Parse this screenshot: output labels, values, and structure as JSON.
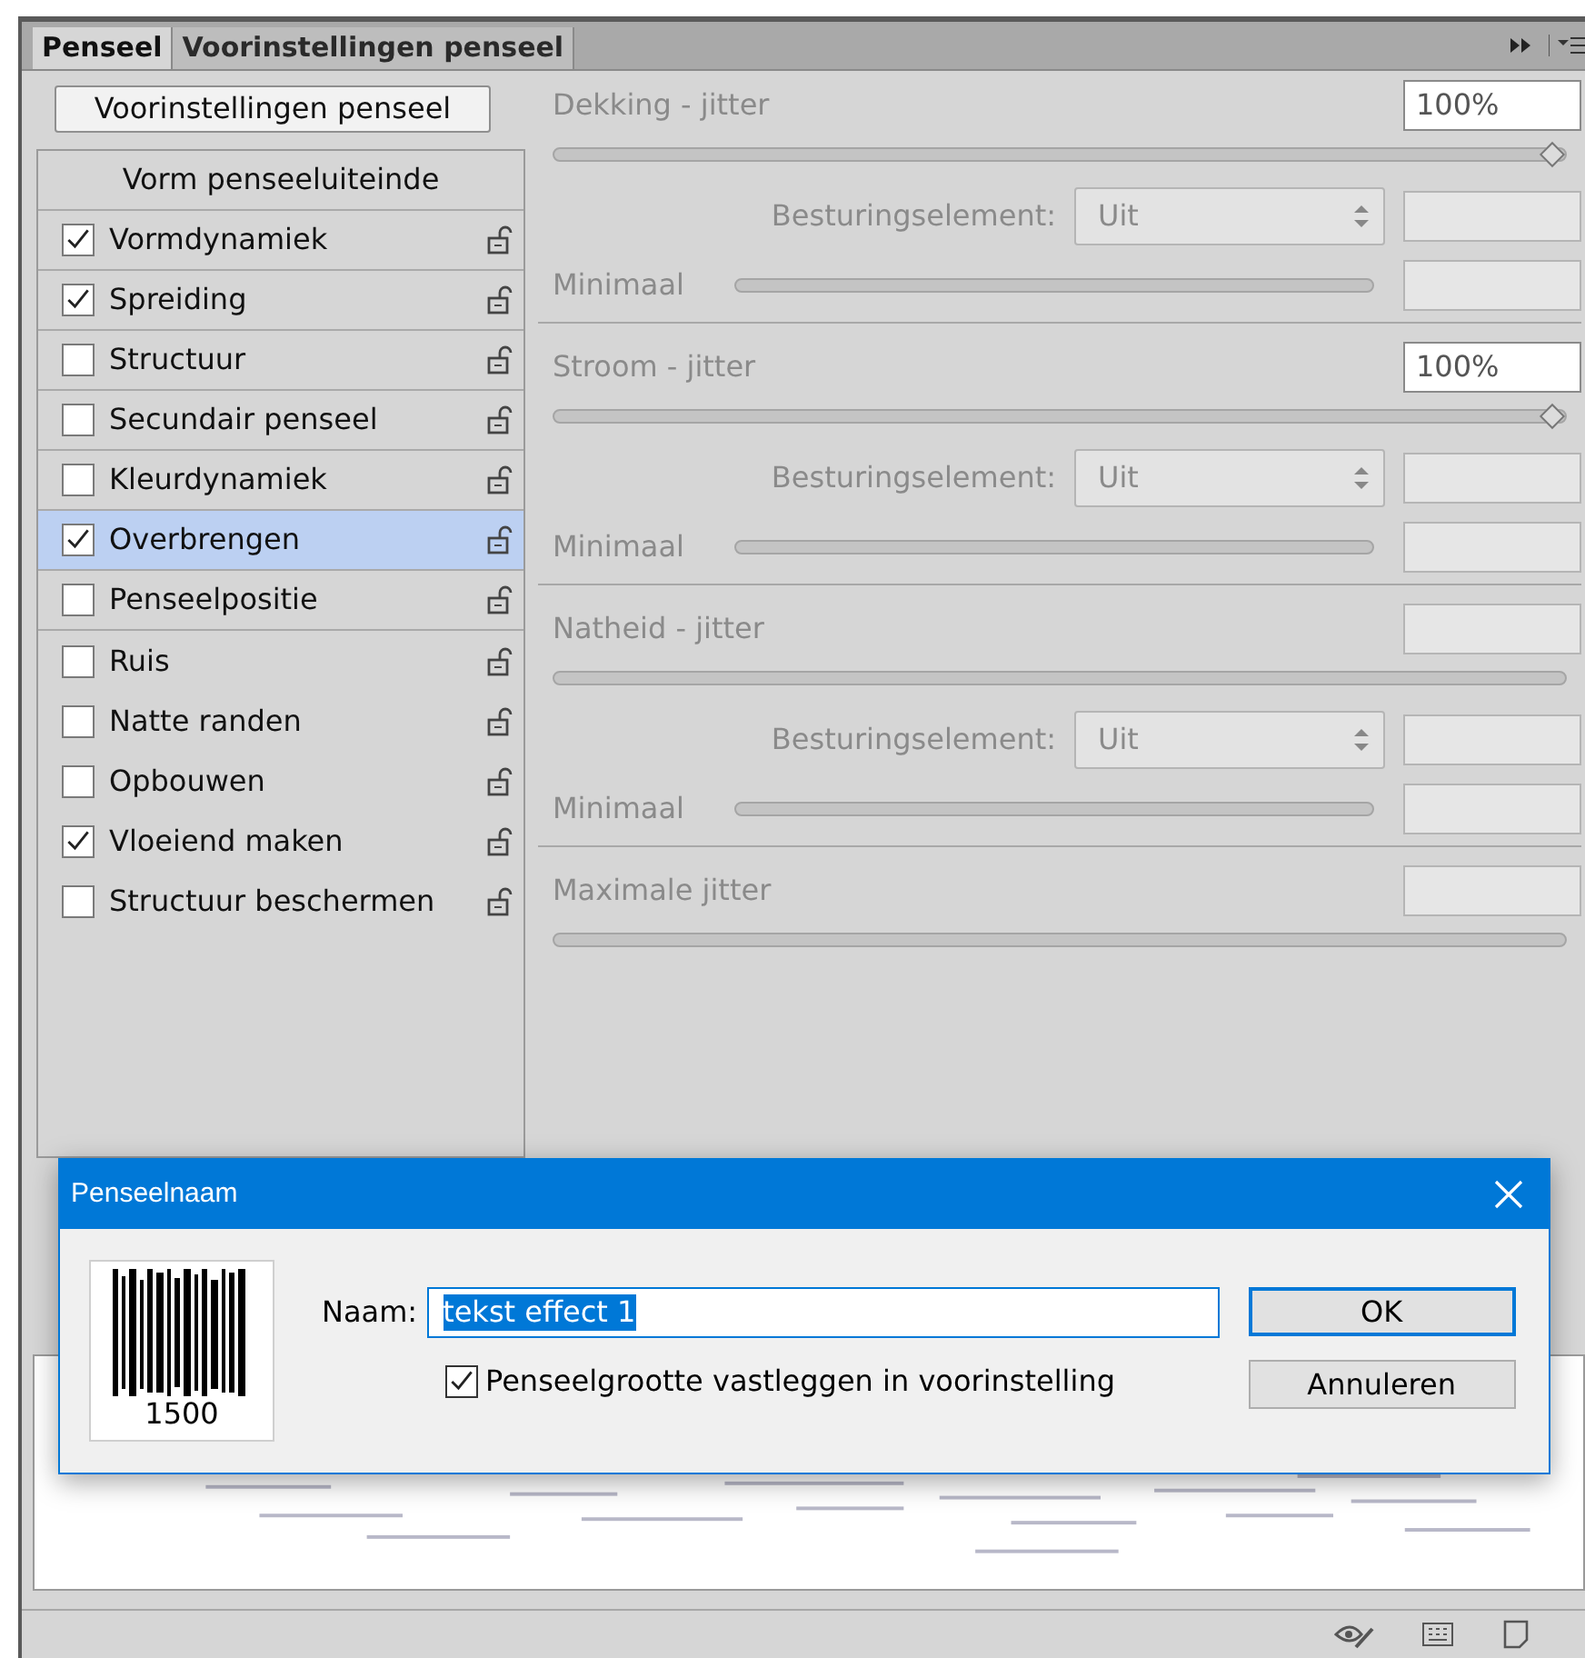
{
  "tabs": [
    {
      "label": "Penseel",
      "selected": true
    },
    {
      "label": "Voorinstellingen penseel",
      "selected": false
    }
  ],
  "presets_button": "Voorinstellingen penseel",
  "brush_settings": [
    {
      "kind": "header",
      "label": "Vorm penseeluiteinde"
    },
    {
      "kind": "option",
      "label": "Vormdynamiek",
      "checked": true,
      "selected": false
    },
    {
      "kind": "option",
      "label": "Spreiding",
      "checked": true,
      "selected": false
    },
    {
      "kind": "option",
      "label": "Structuur",
      "checked": false,
      "selected": false
    },
    {
      "kind": "option",
      "label": "Secundair penseel",
      "checked": false,
      "selected": false
    },
    {
      "kind": "option",
      "label": "Kleurdynamiek",
      "checked": false,
      "selected": false
    },
    {
      "kind": "option",
      "label": "Overbrengen",
      "checked": true,
      "selected": true
    },
    {
      "kind": "option",
      "label": "Penseelpositie",
      "checked": false,
      "selected": false
    },
    {
      "kind": "option",
      "label": "Ruis",
      "checked": false,
      "selected": false
    },
    {
      "kind": "option",
      "label": "Natte randen",
      "checked": false,
      "selected": false
    },
    {
      "kind": "option",
      "label": "Opbouwen",
      "checked": false,
      "selected": false
    },
    {
      "kind": "option",
      "label": "Vloeiend maken",
      "checked": true,
      "selected": false
    },
    {
      "kind": "option",
      "label": "Structuur beschermen",
      "checked": false,
      "selected": false
    }
  ],
  "sections": [
    {
      "title": "Dekking - jitter",
      "value": "100%",
      "level": 1,
      "control_label": "Besturingselement:",
      "control_value": "Uit",
      "minimum_label": "Minimaal"
    },
    {
      "title": "Stroom - jitter",
      "value": "100%",
      "level": 1,
      "control_label": "Besturingselement:",
      "control_value": "Uit",
      "minimum_label": "Minimaal"
    },
    {
      "title": "Natheid - jitter",
      "control_label": "Besturingselement:",
      "control_value": "Uit",
      "minimum_label": "Minimaal"
    },
    {
      "title": "Maximale jitter"
    }
  ],
  "dialog": {
    "title": "Penseelnaam",
    "brush_size": "1500",
    "name_label": "Naam:",
    "name_value": "tekst effect 1",
    "lock_size_label": "Penseelgrootte vastleggen in voorinstelling",
    "lock_size_checked": true,
    "buttons": [
      "OK",
      "Annuleren"
    ]
  }
}
